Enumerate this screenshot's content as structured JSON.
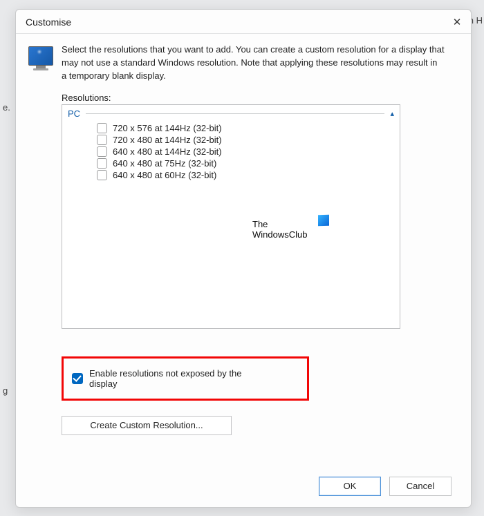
{
  "bg": {
    "left": "e.",
    "right": "n H",
    "g": "g"
  },
  "dialog": {
    "title": "Customise",
    "intro": "Select the resolutions that you want to add. You can create a custom resolution for a display that may not use a standard Windows resolution. Note that applying these resolutions may result in a temporary blank display.",
    "resolutions_label": "Resolutions:",
    "group_name": "PC",
    "items": [
      {
        "label": "720 x 576 at 144Hz (32-bit)"
      },
      {
        "label": "720 x 480 at 144Hz (32-bit)"
      },
      {
        "label": "640 x 480 at 144Hz (32-bit)"
      },
      {
        "label": "640 x 480 at 75Hz (32-bit)"
      },
      {
        "label": "640 x 480 at 60Hz (32-bit)"
      }
    ],
    "watermark_line1": "The",
    "watermark_line2": "WindowsClub",
    "enable_label": "Enable resolutions not exposed by the display",
    "create_label": "Create Custom Resolution...",
    "ok_label": "OK",
    "cancel_label": "Cancel"
  }
}
